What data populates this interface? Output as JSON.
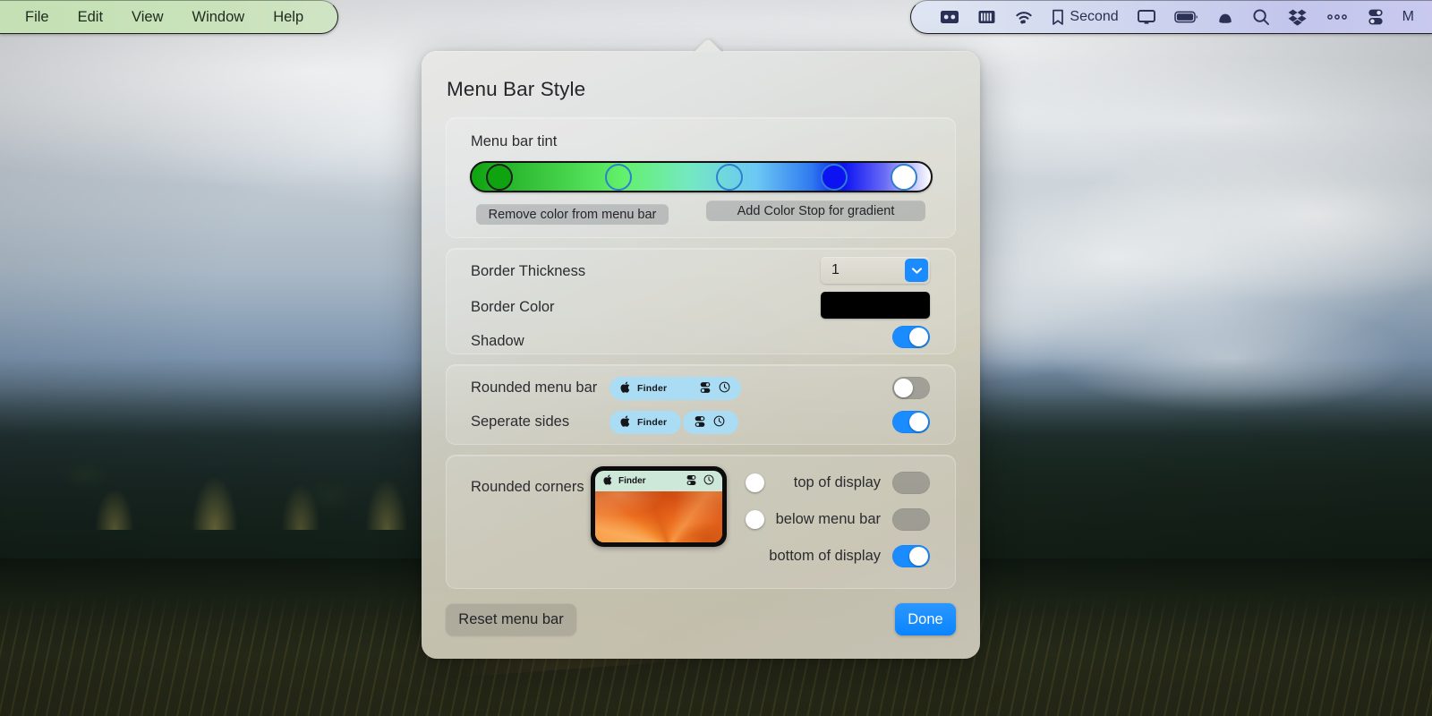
{
  "menubar": {
    "left_menus": [
      "File",
      "Edit",
      "View",
      "Window",
      "Help"
    ],
    "right_items": [
      {
        "name": "bartender-icon",
        "icon": "bartender",
        "label": ""
      },
      {
        "name": "keyboard-icon",
        "icon": "keyboard",
        "label": ""
      },
      {
        "name": "wifi-icon",
        "icon": "wifi",
        "label": ""
      },
      {
        "name": "bookmark-second",
        "icon": "bookmark",
        "label": "Second"
      },
      {
        "name": "display-icon",
        "icon": "display",
        "label": ""
      },
      {
        "name": "battery-icon",
        "icon": "battery",
        "label": ""
      },
      {
        "name": "bell-icon",
        "icon": "bell",
        "label": ""
      },
      {
        "name": "spotlight-search-icon",
        "icon": "search",
        "label": ""
      },
      {
        "name": "dropbox-icon",
        "icon": "dropbox",
        "label": ""
      },
      {
        "name": "overflow-menu-icon",
        "icon": "ellipsis",
        "label": ""
      },
      {
        "name": "control-center-icon",
        "icon": "controlcenter",
        "label": ""
      },
      {
        "name": "clipped-menu-letter",
        "icon": "none",
        "label": "M"
      }
    ]
  },
  "popover": {
    "title": "Menu Bar Style",
    "tint": {
      "section_label": "Menu bar tint",
      "remove_button": "Remove color from menu bar",
      "add_button": "Add Color Stop for gradient",
      "gradient_stops": [
        {
          "position_pct": 3.4,
          "color": "#0fa30f",
          "selected": true
        },
        {
          "position_pct": 31.5,
          "color": "#63f06b",
          "selected": false
        },
        {
          "position_pct": 55.8,
          "color": "#6cc8f4",
          "selected": false
        },
        {
          "position_pct": 78.5,
          "color": "#0c12f2",
          "selected": false
        },
        {
          "position_pct": 95.5,
          "color": "#ffffff",
          "selected": false
        }
      ]
    },
    "border": {
      "thickness_label": "Border Thickness",
      "thickness_value": "1",
      "color_label": "Border Color",
      "color_value": "#000000",
      "shadow_label": "Shadow",
      "shadow_on": true
    },
    "shape": {
      "rounded_label": "Rounded menu bar",
      "rounded_on": false,
      "separate_label": "Seperate sides",
      "separate_on": true,
      "preview_app_name": "Finder"
    },
    "corners": {
      "label": "Rounded corners",
      "preview_app_name": "Finder",
      "options": [
        {
          "label": "top of display",
          "on": false
        },
        {
          "label": "below menu bar",
          "on": false
        },
        {
          "label": "bottom of display",
          "on": true
        }
      ]
    },
    "footer": {
      "reset_label": "Reset menu bar",
      "done_label": "Done"
    }
  },
  "colors": {
    "accent_blue": "#0a84ff",
    "menubar_left_tint": "#c9e2ba",
    "menubar_right_tint": "#c6cbee",
    "preview_tint": "#aadcf4",
    "border_color": "#000000"
  }
}
